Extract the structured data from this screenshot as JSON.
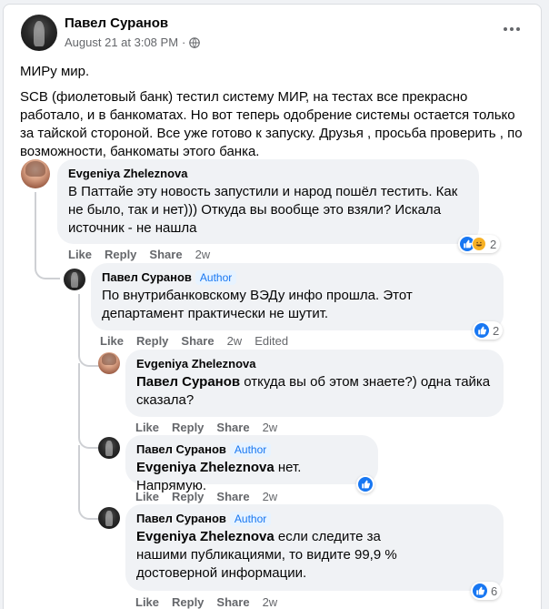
{
  "post": {
    "author": "Павел Суранов",
    "date": "August 21 at 3:08 PM",
    "separator": "·",
    "title_line": "МИРу мир.",
    "body": "SCB (фиолетовый банк) тестил систему МИР, на тестах все прекрасно работало, и в банкоматах. Но вот теперь одобрение системы остается только за тайской стороной. Все уже готово к запуску.  Друзья , просьба проверить , по возможности, банкоматы этого банка.",
    "more_icon": "more-horizontal-icon",
    "privacy_icon": "globe-icon"
  },
  "actions_labels": {
    "like": "Like",
    "reply": "Reply",
    "share": "Share"
  },
  "comments": [
    {
      "author": "Evgeniya Zheleznova",
      "text": "В Паттайе эту новость запустили и народ пошёл тестить. Как не было, так и нет))) Откуда вы вообще это взяли? Искала источник - не нашла",
      "time": "2w",
      "reactions": [
        "like",
        "haha"
      ],
      "reaction_count": "2"
    },
    {
      "author": "Павел Суранов",
      "badge": "Author",
      "text": "По внутрибанковскому ВЭДу инфо прошла. Этот департамент практически не шутит.",
      "time": "2w",
      "edited": "Edited",
      "reactions": [
        "like"
      ],
      "reaction_count": "2"
    },
    {
      "author": "Evgeniya Zheleznova",
      "mention": "Павел Суранов",
      "text": " откуда вы об этом знаете?) одна тайка сказала?",
      "time": "2w"
    },
    {
      "author": "Павел Суранов",
      "badge": "Author",
      "mention": "Evgeniya Zheleznova",
      "text": " нет. Напрямую.",
      "time": "2w",
      "reactions": [
        "like"
      ]
    },
    {
      "author": "Павел Суранов",
      "badge": "Author",
      "mention": "Evgeniya Zheleznova",
      "text": " если следите за нашими публикациями, то видите 99,9 % достоверной информации.",
      "time": "2w",
      "reactions": [
        "like"
      ],
      "reaction_count": "6"
    }
  ],
  "colors": {
    "accent": "#1877f2",
    "badge_bg": "#e7f3ff",
    "bubble": "#f0f2f5",
    "muted": "#65676b"
  }
}
